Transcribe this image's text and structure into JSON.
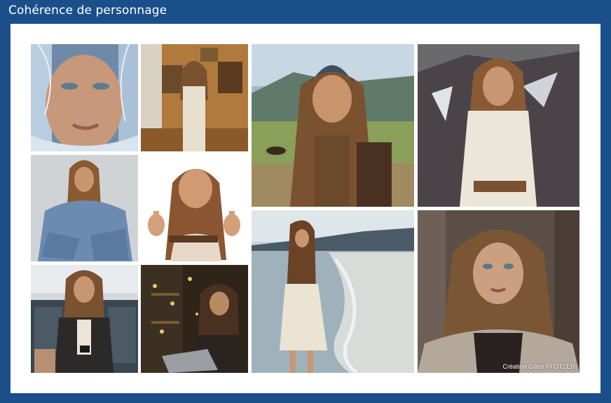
{
  "title": "Cohérence de personnage",
  "credit": "Création Gilles PFOTZER",
  "photos": [
    {
      "name": "frost-closeup-photo"
    },
    {
      "name": "vintage-room-photo"
    },
    {
      "name": "beanie-mountain-photo"
    },
    {
      "name": "white-turtleneck-photo"
    },
    {
      "name": "denim-seated-photo"
    },
    {
      "name": "thumbs-up-photo"
    },
    {
      "name": "beach-walk-photo"
    },
    {
      "name": "fur-collar-portrait-photo"
    },
    {
      "name": "airport-phone-photo"
    },
    {
      "name": "laptop-workshop-photo"
    }
  ]
}
